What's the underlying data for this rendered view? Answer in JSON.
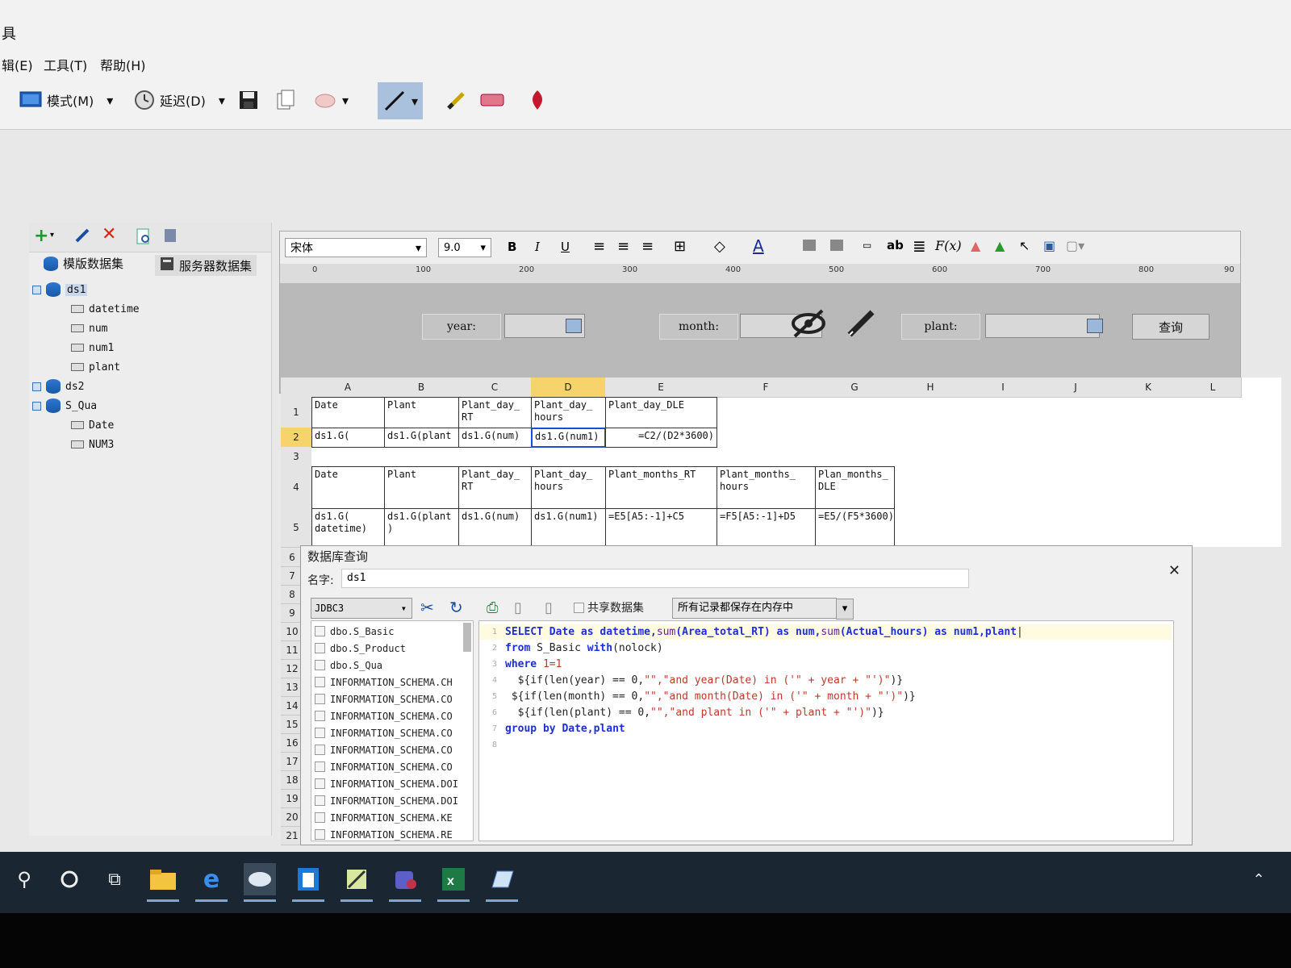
{
  "window": {
    "title_fragment": "具"
  },
  "menu": {
    "items": [
      "辑(E)",
      "工具(T)",
      "帮助(H)"
    ]
  },
  "toolbar": {
    "mode_label": "模式(M)",
    "delay_label": "延迟(D)"
  },
  "left_panel": {
    "tabs": [
      "模版数据集",
      "服务器数据集"
    ],
    "tree": [
      {
        "label": "ds1",
        "level": 0
      },
      {
        "label": "datetime",
        "level": 1
      },
      {
        "label": "num",
        "level": 1
      },
      {
        "label": "num1",
        "level": 1
      },
      {
        "label": "plant",
        "level": 1
      },
      {
        "label": "ds2",
        "level": 0
      },
      {
        "label": "S_Qua",
        "level": 0
      },
      {
        "label": "Date",
        "level": 1
      },
      {
        "label": "NUM3",
        "level": 1
      }
    ]
  },
  "format_bar": {
    "font": "宋体",
    "size": "9.0"
  },
  "ruler": {
    "ticks": [
      "0",
      "100",
      "200",
      "300",
      "400",
      "500",
      "600",
      "700",
      "800",
      "90"
    ]
  },
  "params": {
    "year": "year:",
    "month": "month:",
    "plant": "plant:",
    "query": "查询"
  },
  "grid": {
    "columns": [
      "A",
      "B",
      "C",
      "D",
      "E",
      "F",
      "G",
      "H",
      "I",
      "J",
      "K",
      "L"
    ],
    "rows": [
      "1",
      "2",
      "3",
      "4",
      "5"
    ],
    "r1": [
      "Date",
      "Plant",
      "Plant_day_ RT",
      "Plant_day_ hours",
      "Plant_day_DLE"
    ],
    "r2": [
      "ds1.G(",
      "ds1.G(plant",
      "ds1.G(num)",
      "ds1.G(num1)",
      "=C2/(D2*3600)"
    ],
    "r4": [
      "Date",
      "Plant",
      "Plant_day_ RT",
      "Plant_day_ hours",
      "Plant_months_RT",
      "Plant_months_ hours",
      "Plan_months_ DLE"
    ],
    "r5": [
      "ds1.G( datetime)",
      "ds1.G(plant )",
      "ds1.G(num)",
      "ds1.G(num1)",
      "=E5[A5:-1]+C5",
      "=F5[A5:-1]+D5",
      "=E5/(F5*3600)"
    ]
  },
  "dialog": {
    "title": "数据库查询",
    "name_label": "名字:",
    "name_value": "ds1",
    "connection": "JDBC3",
    "share_label": "共享数据集",
    "memory_option": "所有记录都保存在内存中",
    "tables": [
      "dbo.S_Basic",
      "dbo.S_Product",
      "dbo.S_Qua",
      "INFORMATION_SCHEMA.CH",
      "INFORMATION_SCHEMA.CO",
      "INFORMATION_SCHEMA.CO",
      "INFORMATION_SCHEMA.CO",
      "INFORMATION_SCHEMA.CO",
      "INFORMATION_SCHEMA.CO",
      "INFORMATION_SCHEMA.DOI",
      "INFORMATION_SCHEMA.DOI",
      "INFORMATION_SCHEMA.KE",
      "INFORMATION_SCHEMA.RE"
    ],
    "sql": {
      "l1": [
        "SELECT Date as datetime,",
        "sum",
        "(Area_total_RT) as num,",
        "sum",
        "(Actual_hours) as num1,plant"
      ],
      "l2": [
        "from",
        " S_Basic ",
        "with",
        "(nolock)"
      ],
      "l3": [
        "where",
        " 1=1"
      ],
      "l4": [
        "  ${if(len(year) == 0,",
        "\"\",\"and year(Date) in ('\" + year + \"')\"",
        ")}"
      ],
      "l5": [
        " ${if(len(month) == 0,",
        "\"\",\"and month(Date) in ('\" + month + \"')\"",
        ")}"
      ],
      "l6": [
        "  ${if(len(plant) == 0,",
        "\"\",\"and plant in ('\" + plant + \"')\"",
        ")}"
      ],
      "l7": [
        "group by",
        " Date,plant"
      ]
    },
    "line_numbers": [
      "1",
      "2",
      "3",
      "4",
      "5",
      "6",
      "7",
      "8"
    ]
  },
  "row_numbers": [
    "6",
    "7",
    "8",
    "9",
    "10",
    "11",
    "12",
    "13",
    "14",
    "15",
    "16",
    "17",
    "18",
    "19",
    "20",
    "21"
  ],
  "colors": {
    "accent": "#1d2fd6",
    "selection": "#f6d36b",
    "taskbar": "#1b2633"
  }
}
